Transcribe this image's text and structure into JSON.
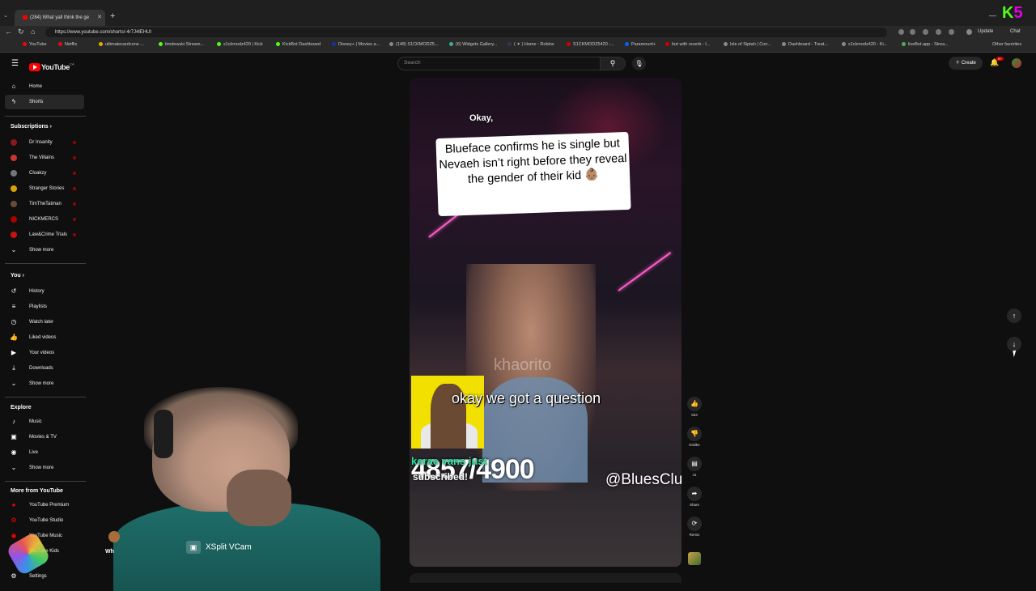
{
  "browser": {
    "tab_title": "(284) What yall think the ge",
    "url": "https://www.youtube.com/shorts/-4r7J4lEHUI",
    "update_label": "Update",
    "chat_label": "Chat",
    "bookmarks": [
      "YouTube",
      "Netflix",
      "ultimatecardcone ...",
      "timdewski Stream...",
      "s1ckmodz420 | Kick",
      "KickBot Dashboard",
      "Disney+ | Movies a...",
      "(148) S1CKMODZ5...",
      "(6) Widgets Gallery...",
      "( ✦ ) Home - Roblox",
      "S1CKMODZ5420 -...",
      "Paramount+",
      "fart with reverb - I...",
      "Isle of Siptah | Con...",
      "Dashboard - Treat...",
      "s1ckmodz420 - Ki...",
      "liveBot.app - Strea..."
    ],
    "other_favorites": "Other favorites",
    "colors": {
      "kick_green": "#53fc18",
      "kick_magenta": "#e600e6"
    }
  },
  "youtube": {
    "logo_text": "YouTube",
    "logo_sup": "CA",
    "search_placeholder": "Search",
    "create_label": "Create",
    "notification_count": "9+",
    "brand_color": "#ff0000"
  },
  "sidebar": {
    "main": [
      {
        "label": "Home",
        "icon": "home-icon"
      },
      {
        "label": "Shorts",
        "icon": "shorts-icon",
        "active": true
      }
    ],
    "subscriptions_header": "Subscriptions",
    "subscriptions": [
      "Dr Insanity",
      "The Villains",
      "Cloakzy",
      "Stranger Stories",
      "TimTheTatman",
      "NICKMERCS",
      "Law&Crime Trials"
    ],
    "subs_show_more": "Show more",
    "you_header": "You",
    "you_items": [
      {
        "label": "History",
        "icon": "history-icon"
      },
      {
        "label": "Playlists",
        "icon": "playlists-icon"
      },
      {
        "label": "Watch later",
        "icon": "watch-later-icon"
      },
      {
        "label": "Liked videos",
        "icon": "like-icon"
      },
      {
        "label": "Your videos",
        "icon": "your-videos-icon"
      },
      {
        "label": "Downloads",
        "icon": "download-icon"
      }
    ],
    "you_show_more": "Show more",
    "explore_header": "Explore",
    "explore_items": [
      {
        "label": "Music",
        "icon": "music-icon"
      },
      {
        "label": "Movies & TV",
        "icon": "movies-icon"
      },
      {
        "label": "Live",
        "icon": "live-icon"
      }
    ],
    "explore_show_more": "Show more",
    "more_header": "More from YouTube",
    "more_items": [
      "YouTube Premium",
      "YouTube Studio",
      "YouTube Music",
      "YouTube Kids"
    ],
    "settings_label": "Settings"
  },
  "short": {
    "caption_small": "Okay,",
    "caption_main": "Blueface confirms he is single but Nevaeh isn’t right before they reveal the gender of their kid 👶🏽",
    "overlay_question": "okay we got a question",
    "subscriber_name": "kerae vans",
    "subscriber_count": "4857/4900",
    "subscriber_text": "subscribed!",
    "subscriber_suffix": "just",
    "handle": "@BluesClu",
    "watermark": "khaorito",
    "actions": [
      {
        "label": "833",
        "icon": "like-icon"
      },
      {
        "label": "Dislike",
        "icon": "dislike-icon"
      },
      {
        "label": "41",
        "icon": "comment-icon"
      },
      {
        "label": "Share",
        "icon": "share-icon"
      },
      {
        "label": "Remix",
        "icon": "remix-icon"
      }
    ]
  },
  "overlay": {
    "xsplit_label": "XSplit VCam",
    "chat_snippet": "Wh"
  }
}
